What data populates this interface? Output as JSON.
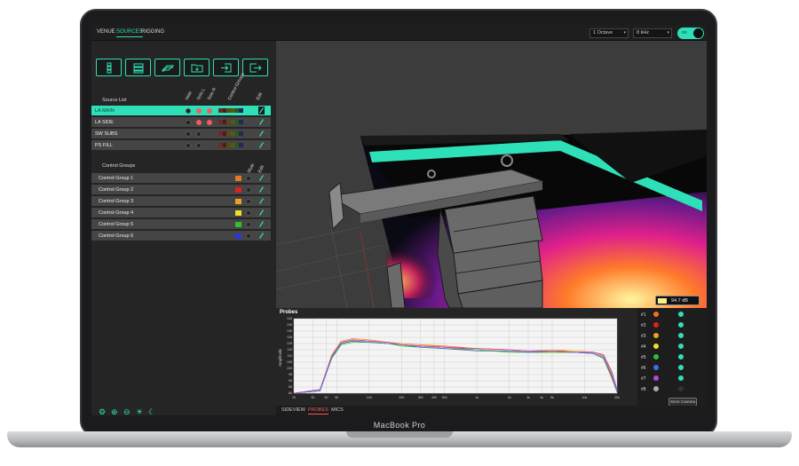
{
  "device": {
    "model": "MacBook Pro"
  },
  "topbar": {
    "tabs": [
      "VENUE",
      "SOURCES",
      "RIGGING"
    ],
    "active_tab": "SOURCES",
    "resolution": "1 Octave",
    "frequency": "8 kHz",
    "power_label": "on"
  },
  "source_list": {
    "title": "Source List",
    "columns": [
      "Hide",
      "Solo L",
      "Solo R",
      "Control Groups",
      "Edit"
    ],
    "rows": [
      {
        "name": "LA  MAIN",
        "selected": true
      },
      {
        "name": "LA  SIDE",
        "selected": false
      },
      {
        "name": "SW  SUBS",
        "selected": false
      },
      {
        "name": "PS  FILL",
        "selected": false
      }
    ]
  },
  "control_groups": {
    "title": "Control Groups",
    "columns": [
      "Mute",
      "Edit"
    ],
    "rows": [
      {
        "name": "Control Group 1",
        "color": "#e87722"
      },
      {
        "name": "Control Group 2",
        "color": "#e02020"
      },
      {
        "name": "Control Group 3",
        "color": "#f0a020"
      },
      {
        "name": "Control Group 4",
        "color": "#f0e020"
      },
      {
        "name": "Control Group 5",
        "color": "#30c030"
      },
      {
        "name": "Control Group 6",
        "color": "#2a38d8"
      }
    ]
  },
  "probes": {
    "title": "Probes",
    "ylabel": "Amplitude",
    "level": "94.7 dB",
    "list": [
      {
        "label": "#1",
        "color": "#e87722"
      },
      {
        "label": "#2",
        "color": "#e02020"
      },
      {
        "label": "#3",
        "color": "#f0a020"
      },
      {
        "label": "#4",
        "color": "#f0e020"
      },
      {
        "label": "#5",
        "color": "#30c030"
      },
      {
        "label": "#6",
        "color": "#4070e0"
      },
      {
        "label": "#7",
        "color": "#c040e0"
      },
      {
        "label": "#8",
        "color": "#aaaaaa"
      }
    ],
    "button": "Store Camera"
  },
  "bottom_tabs": [
    "SIDEVIEW",
    "PROBES",
    "MICS"
  ],
  "active_bottom_tab": "PROBES",
  "chart_data": {
    "type": "line",
    "title": "",
    "xlabel": "",
    "ylabel": "Amplitude",
    "x_log": true,
    "xlim": [
      20,
      20000
    ],
    "ylim": [
      80,
      140
    ],
    "x_ticks": [
      "20",
      "30",
      "40",
      "50",
      "100",
      "200",
      "300",
      "400",
      "500",
      "1k",
      "2k",
      "3k",
      "4k",
      "5k",
      "10k",
      "20k"
    ],
    "y_ticks": [
      "140",
      "135",
      "130",
      "125",
      "120",
      "115",
      "110",
      "105",
      "100",
      "95",
      "90",
      "85",
      "80"
    ],
    "series": [
      {
        "color": "#e87722",
        "x": [
          20,
          35,
          45,
          55,
          70,
          100,
          150,
          200,
          300,
          500,
          1000,
          2000,
          3000,
          5000,
          8000,
          12000,
          15000,
          18000,
          20000
        ],
        "y": [
          80,
          82,
          110,
          121,
          123,
          122,
          121,
          120,
          119,
          118,
          116,
          115,
          114,
          114,
          114,
          113,
          110,
          95,
          82
        ]
      },
      {
        "color": "#e02020",
        "x": [
          20,
          35,
          45,
          55,
          70,
          100,
          150,
          200,
          300,
          500,
          1000,
          2000,
          3000,
          5000,
          8000,
          12000,
          15000,
          18000,
          20000
        ],
        "y": [
          80,
          82,
          109,
          120,
          122,
          121,
          120,
          119,
          118,
          117,
          115,
          114,
          113,
          113,
          113,
          112,
          108,
          92,
          81
        ]
      },
      {
        "color": "#f0a020",
        "x": [
          20,
          35,
          45,
          55,
          70,
          100,
          150,
          200,
          300,
          500,
          1000,
          2000,
          3000,
          5000,
          8000,
          12000,
          15000,
          18000,
          20000
        ],
        "y": [
          80,
          83,
          111,
          122,
          124,
          123,
          121,
          120,
          119,
          117,
          116,
          115,
          114,
          115,
          114,
          113,
          111,
          96,
          83
        ]
      },
      {
        "color": "#f0e020",
        "x": [
          20,
          35,
          45,
          55,
          70,
          100,
          150,
          200,
          300,
          500,
          1000,
          2000,
          3000,
          5000,
          8000,
          12000,
          15000,
          18000,
          20000
        ],
        "y": [
          80,
          82,
          110,
          121,
          122,
          122,
          120,
          119,
          118,
          116,
          115,
          114,
          114,
          113,
          114,
          112,
          109,
          94,
          82
        ]
      },
      {
        "color": "#30c030",
        "x": [
          20,
          35,
          45,
          55,
          70,
          100,
          150,
          200,
          300,
          500,
          1000,
          2000,
          3000,
          5000,
          8000,
          12000,
          15000,
          18000,
          20000
        ],
        "y": [
          80,
          82,
          108,
          119,
          121,
          121,
          120,
          118,
          117,
          116,
          115,
          113,
          113,
          113,
          113,
          112,
          108,
          93,
          81
        ]
      },
      {
        "color": "#4070e0",
        "x": [
          20,
          35,
          45,
          55,
          70,
          100,
          150,
          200,
          300,
          500,
          1000,
          2000,
          3000,
          5000,
          8000,
          12000,
          15000,
          18000,
          20000
        ],
        "y": [
          80,
          82,
          109,
          120,
          122,
          121,
          120,
          119,
          117,
          116,
          114,
          114,
          113,
          114,
          113,
          112,
          109,
          94,
          82
        ]
      },
      {
        "color": "#c040e0",
        "x": [
          20,
          35,
          45,
          55,
          70,
          100,
          150,
          200,
          300,
          500,
          1000,
          2000,
          3000,
          5000,
          8000,
          12000,
          15000,
          18000,
          20000
        ],
        "y": [
          80,
          83,
          110,
          121,
          123,
          122,
          121,
          119,
          118,
          117,
          116,
          115,
          114,
          114,
          113,
          113,
          111,
          97,
          83
        ]
      }
    ]
  }
}
